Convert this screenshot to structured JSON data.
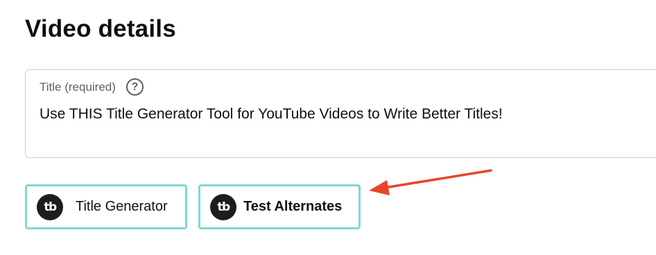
{
  "heading": "Video details",
  "title_field": {
    "label": "Title (required)",
    "help_symbol": "?",
    "value": "Use THIS Title Generator Tool for YouTube Videos to Write Better Titles!"
  },
  "buttons": [
    {
      "label": "Title Generator",
      "icon": "tubebuddy-logo-icon"
    },
    {
      "label": "Test Alternates",
      "icon": "tubebuddy-logo-icon"
    }
  ],
  "logo_text": "tb",
  "colors": {
    "button_border": "#7ddad0",
    "arrow": "#e8452c",
    "heading_text": "#0f0f0f",
    "label_text": "#606060"
  }
}
